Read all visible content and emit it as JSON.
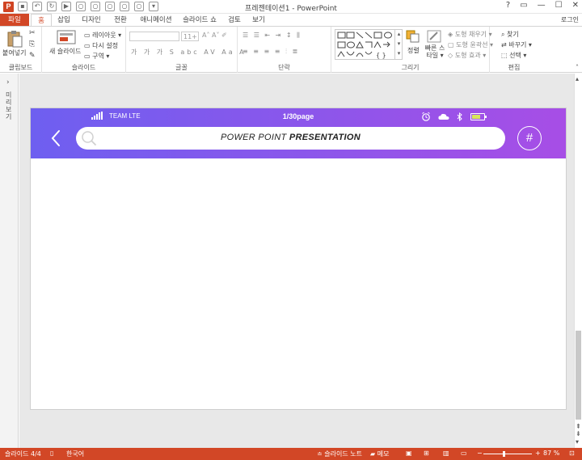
{
  "window": {
    "title": "프레젠테이션1 - PowerPoint",
    "app_letter": "P",
    "controls": [
      "?",
      "▭",
      "—",
      "☐",
      "✕"
    ]
  },
  "ribbon_tabs": [
    {
      "label": "파일"
    },
    {
      "label": "홈"
    },
    {
      "label": "삽입"
    },
    {
      "label": "디자인"
    },
    {
      "label": "전환"
    },
    {
      "label": "애니메이션"
    },
    {
      "label": "슬라이드 쇼"
    },
    {
      "label": "검토"
    },
    {
      "label": "보기"
    }
  ],
  "login_label": "로그인",
  "ribbon": {
    "clipboard": {
      "paste_label": "붙여넣기",
      "group_label": "클립보드"
    },
    "slides": {
      "new_slide_label": "새 슬라이드",
      "layout_label": "레이아웃 ▾",
      "reset_label": "다시 설정",
      "section_label": "구역 ▾",
      "group_label": "슬라이드"
    },
    "font": {
      "size_value": "11+",
      "group_label": "글꼴"
    },
    "paragraph": {
      "group_label": "단락"
    },
    "drawing": {
      "arrange_label": "정렬",
      "quick_styles_label": "빠른 스타일 ▾",
      "fill_label": "도형 채우기 ▾",
      "outline_label": "도형 윤곽선 ▾",
      "effects_label": "도형 효과 ▾",
      "group_label": "그리기"
    },
    "editing": {
      "find_label": "찾기",
      "replace_label": "바꾸기 ▾",
      "select_label": "선택 ▾",
      "group_label": "편집"
    }
  },
  "thumbpane": {
    "label": "미리보기"
  },
  "slide": {
    "status_carrier": "TEAM LTE",
    "status_page": "1/30page",
    "search_text_light": "POWER POINT ",
    "search_text_bold": "PRESENTATION",
    "hash_symbol": "#",
    "battery_level": 0.7,
    "gradient_colors": [
      "#6e5ff0",
      "#a74ee6"
    ]
  },
  "statusbar": {
    "slide_info": "슬라이드 4/4",
    "language": "한국어",
    "notes_label": "슬라이드 노트",
    "comments_label": "메모",
    "zoom": "87 %",
    "zoom_minus": "−",
    "zoom_plus": "+"
  }
}
